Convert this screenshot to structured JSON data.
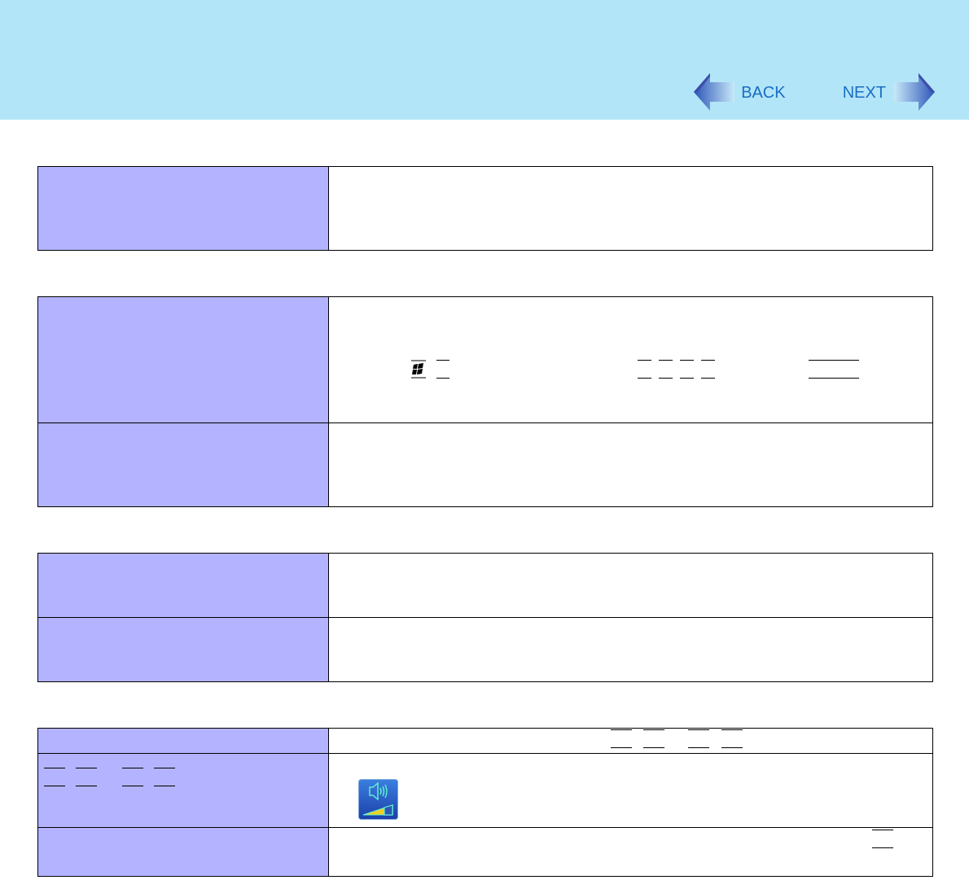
{
  "navigation": {
    "back": "BACK",
    "next": "NEXT"
  }
}
